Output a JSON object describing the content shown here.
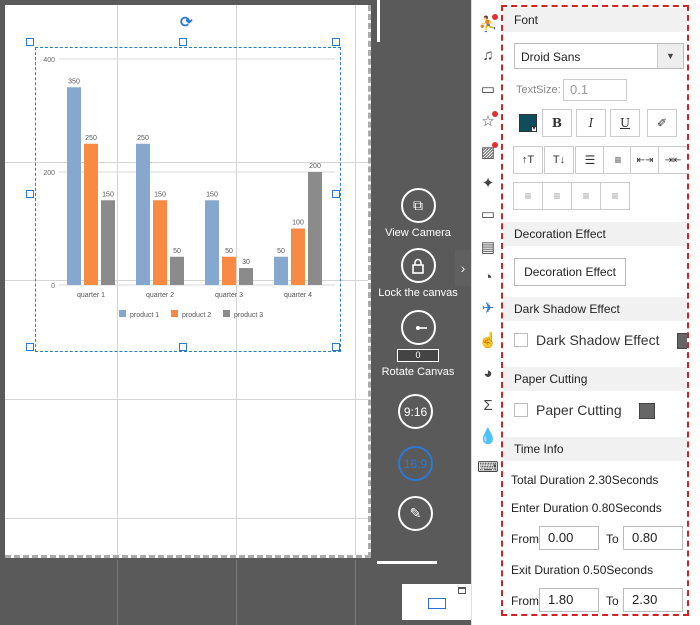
{
  "tools": {
    "view_camera": "View Camera",
    "lock_canvas": "Lock the canvas",
    "rotate_canvas": "Rotate Canvas",
    "rotate_value": "0",
    "ratio_916": "9:16",
    "ratio_169": "16:9"
  },
  "toolbar_icons": [
    "figure-icon",
    "music-note-icon",
    "speech-bubble-icon",
    "star-frame-icon",
    "image-icon",
    "magic-wand-icon",
    "folder-icon",
    "film-icon",
    "swoosh-icon",
    "airplane-icon",
    "hand-icon",
    "pie-chart-icon",
    "sigma-icon",
    "droplet-icon",
    "keyboard-icon"
  ],
  "panel": {
    "font_section": "Font",
    "font_family": "Droid Sans",
    "textsize_label": "TextSize:",
    "textsize_value": "0.1",
    "decoration_section": "Decoration Effect",
    "decoration_button": "Decoration Effect",
    "dark_shadow_section": "Dark Shadow Effect",
    "dark_shadow_checkbox": "Dark Shadow Effect",
    "paper_cutting_section": "Paper Cutting",
    "paper_cutting_checkbox": "Paper Cutting",
    "time_section": "Time Info",
    "total_duration": "Total Duration  2.30Seconds",
    "enter_duration": "Enter Duration 0.80Seconds",
    "enter_from": "0.00",
    "enter_to": "0.80",
    "exit_duration": "Exit Duration  0.50Seconds",
    "exit_from": "1.80",
    "exit_to": "2.30",
    "from_label": "From",
    "to_label": "To"
  },
  "chart_data": {
    "type": "bar",
    "categories": [
      "quarter 1",
      "quarter 2",
      "quarter 3",
      "quarter 4"
    ],
    "series": [
      {
        "name": "product 1",
        "values": [
          350,
          250,
          150,
          50
        ],
        "color": "#86a8cf"
      },
      {
        "name": "product 2",
        "values": [
          250,
          150,
          50,
          100
        ],
        "color": "#f98a43"
      },
      {
        "name": "product 3",
        "values": [
          150,
          50,
          30,
          200
        ],
        "color": "#8b8b8b"
      }
    ],
    "yticks": [
      "0",
      "200",
      "400"
    ],
    "ylim": [
      0,
      400
    ],
    "legend": "bottom",
    "grid": true
  }
}
